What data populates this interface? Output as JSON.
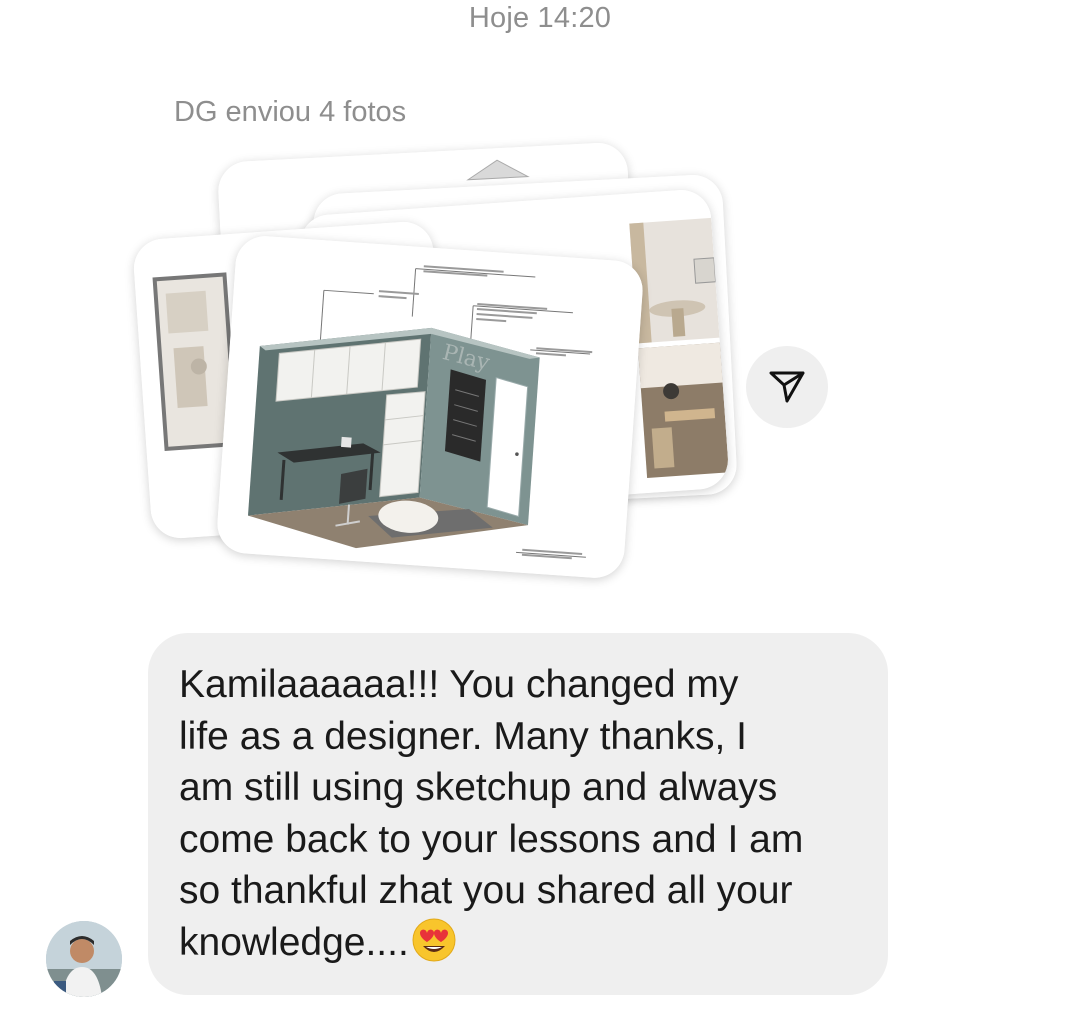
{
  "thread": {
    "timestamp": "Hoje 14:20",
    "sender_note": "DG enviou 4 fotos"
  },
  "photos": {
    "count": 4,
    "items": [
      {
        "icon": "floor-plan-thumbnail"
      },
      {
        "icon": "room-render-thumbnail"
      },
      {
        "icon": "interior-photo-thumbnail"
      },
      {
        "icon": "isometric-room-sketch"
      }
    ],
    "sketch_wall_text": "Play"
  },
  "actions": {
    "share_icon": "paper-plane-icon"
  },
  "message": {
    "lines": [
      "Kamilaaaaaa!!! You changed my",
      "life as a designer. Many thanks, I",
      "am still using sketchup and always",
      "come back to your lessons and I am",
      "so thankful zhat you shared all your",
      "knowledge...."
    ],
    "emoji": "heart-eyes-emoji",
    "bubble_color": "#efefef"
  },
  "colors": {
    "meta_text": "#8e8e8e",
    "body_text": "#1a1a1a",
    "background": "#ffffff"
  }
}
